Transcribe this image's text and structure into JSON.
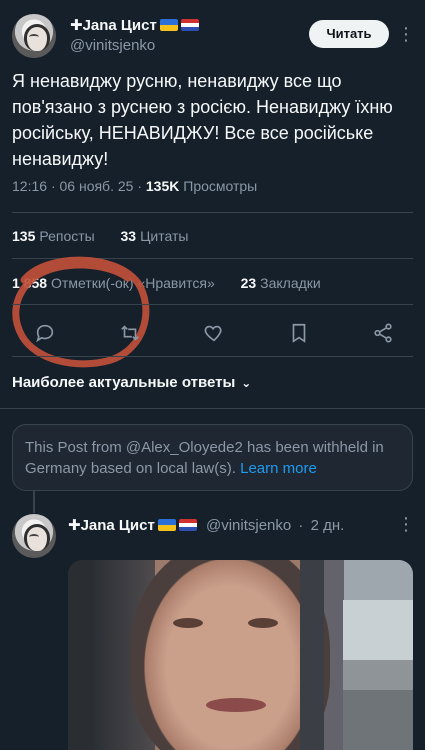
{
  "post": {
    "author_name": "✚Jana Цист",
    "handle": "@vinitsjenko",
    "read_button": "Читать",
    "more": "⋮",
    "text": "Я ненавиджу русню, ненавиджу все що пов'язано з руснею з росією. Ненавиджу їхню російську, НЕНАВИДЖУ! Все все російське ненавиджу!",
    "time": "12:16",
    "date": "06 нояб. 25",
    "views_count": "135K",
    "views_label": "Просмотры"
  },
  "stats": {
    "reposts_count": "135",
    "reposts_label": "Репосты",
    "quotes_count": "33",
    "quotes_label": "Цитаты",
    "likes_count": "1 858",
    "likes_label": "Отметки(-ок) «Нравится»",
    "bookmarks_count": "23",
    "bookmarks_label": "Закладки"
  },
  "actions": [
    "reply",
    "repost",
    "like",
    "bookmark",
    "share"
  ],
  "replies": {
    "sort_label": "Наиболее актуальные ответы",
    "chevron": "⌄"
  },
  "withheld": {
    "text": "This Post from @Alex_Oloyede2 has been withheld in Germany based on local law(s).",
    "link": "Learn more"
  },
  "reply": {
    "author_name": "✚Jana Цист",
    "handle": "@vinitsjenko",
    "age": "2 дн.",
    "more": "⋮"
  },
  "colors": {
    "background": "#15202b",
    "accent": "#1d9bf0",
    "scribble": "#c0503a"
  }
}
